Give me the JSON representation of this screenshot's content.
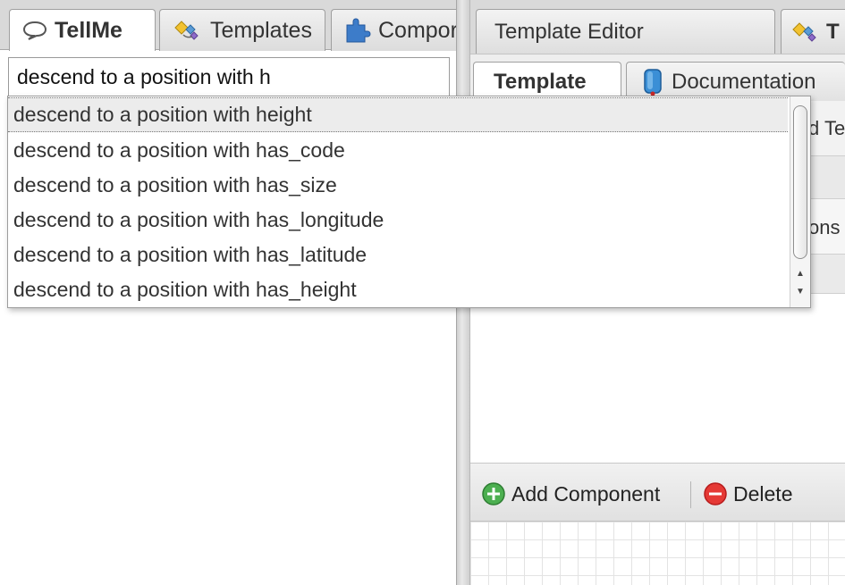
{
  "left_tabs": [
    {
      "label": "TellMe",
      "icon": "speech-bubble-icon",
      "active": true
    },
    {
      "label": "Templates",
      "icon": "templates-icon",
      "active": false
    },
    {
      "label": "Compor",
      "icon": "puzzle-piece-icon",
      "active": false
    }
  ],
  "search": {
    "value": "descend to a position with h"
  },
  "suggestions": [
    "descend to a position with height",
    "descend to a position with has_code",
    "descend to a position with has_size",
    "descend to a position with has_longitude",
    "descend to a position with has_latitude",
    "descend to a position with has_height"
  ],
  "right_tabs": [
    {
      "label": "Template Editor"
    },
    {
      "label": "T",
      "icon": "templates-icon"
    }
  ],
  "right_subtabs": [
    {
      "label": "Template",
      "active": true
    },
    {
      "label": "Documentation",
      "icon": "book-icon"
    }
  ],
  "partial_texts": {
    "row1": "d Te",
    "row2": "ons"
  },
  "toolbar": {
    "add_label": "Add Component",
    "delete_label": "Delete"
  },
  "colors": {
    "add_green": "#4caf50",
    "delete_red": "#e53935",
    "template_icon_yellow": "#f2c230",
    "template_icon_blue": "#5a9bd5",
    "puzzle_blue": "#3d7cc9"
  }
}
